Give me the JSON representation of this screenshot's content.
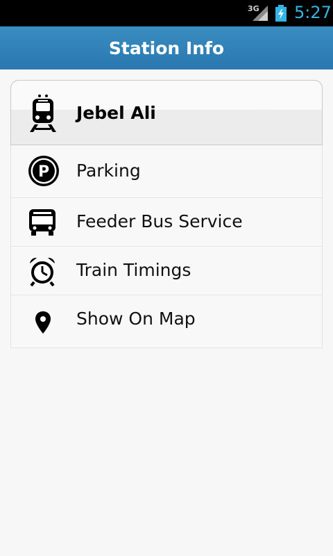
{
  "status_bar": {
    "network_label": "3G",
    "time": "5:27",
    "icons": [
      "signal-icon",
      "battery-charging-icon"
    ]
  },
  "action_bar": {
    "title": "Station Info"
  },
  "station": {
    "name": "Jebel Ali",
    "icon": "train-icon"
  },
  "menu": [
    {
      "label": "Parking",
      "icon": "parking-icon"
    },
    {
      "label": "Feeder Bus Service",
      "icon": "bus-icon"
    },
    {
      "label": "Train Timings",
      "icon": "alarm-clock-icon"
    },
    {
      "label": "Show On Map",
      "icon": "map-pin-icon"
    }
  ],
  "colors": {
    "action_bar": "#2978b0",
    "status_accent": "#33b5e5",
    "background": "#f7f7f7"
  }
}
